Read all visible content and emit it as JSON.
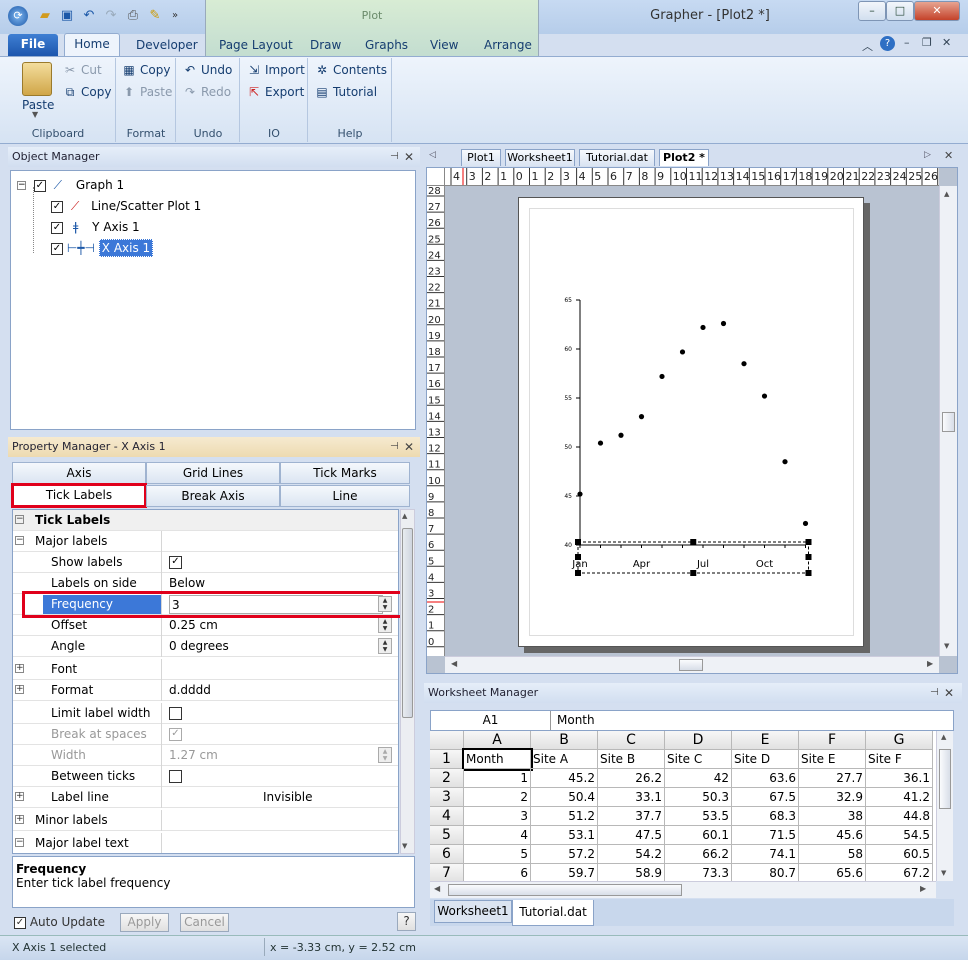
{
  "window": {
    "title": "Grapher - [Plot2 *]",
    "context_group": "Plot",
    "min": "–",
    "max": "□",
    "close": "✕"
  },
  "ribbon": {
    "tabs": [
      "File",
      "Home",
      "Developer",
      "Page Layout",
      "Draw",
      "Graphs",
      "View",
      "Arrange"
    ],
    "clipboard": {
      "label": "Clipboard",
      "paste": "Paste",
      "cut": "Cut",
      "copy": "Copy"
    },
    "format": {
      "label": "Format",
      "copy": "Copy",
      "paste": "Paste"
    },
    "undo": {
      "label": "Undo",
      "undo": "Undo",
      "redo": "Redo"
    },
    "io": {
      "label": "IO",
      "import": "Import",
      "export": "Export"
    },
    "help": {
      "label": "Help",
      "contents": "Contents",
      "tutorial": "Tutorial"
    }
  },
  "object_manager": {
    "title": "Object Manager",
    "items": [
      "Graph 1",
      "Line/Scatter Plot 1",
      "Y Axis 1",
      "X Axis 1"
    ]
  },
  "property_manager": {
    "title": "Property Manager - X Axis 1",
    "tabs": [
      "Axis",
      "Grid Lines",
      "Tick Marks",
      "Tick Labels",
      "Break Axis",
      "Line"
    ],
    "section": "Tick Labels",
    "rows": [
      {
        "label": "Major labels",
        "value": ""
      },
      {
        "label": "Show labels",
        "value": ""
      },
      {
        "label": "Labels on side",
        "value": "Below"
      },
      {
        "label": "Frequency",
        "value": "3"
      },
      {
        "label": "Offset",
        "value": "0.25 cm"
      },
      {
        "label": "Angle",
        "value": "0 degrees"
      },
      {
        "label": "Font",
        "value": ""
      },
      {
        "label": "Format",
        "value": "d.dddd"
      },
      {
        "label": "Limit label width",
        "value": ""
      },
      {
        "label": "Break at spaces",
        "value": ""
      },
      {
        "label": "Width",
        "value": "1.27 cm"
      },
      {
        "label": "Between ticks",
        "value": ""
      },
      {
        "label": "Label line",
        "value": "Invisible"
      },
      {
        "label": "Minor labels",
        "value": ""
      },
      {
        "label": "Major label text",
        "value": ""
      }
    ],
    "help_title": "Frequency",
    "help_text": "Enter tick label frequency",
    "auto_update": "Auto Update",
    "apply": "Apply",
    "cancel": "Cancel",
    "help_btn": "?"
  },
  "doc_tabs": [
    "Plot1",
    "Worksheet1",
    "Tutorial.dat",
    "Plot2 *"
  ],
  "ruler": {
    "h": [
      "4",
      "3",
      "2",
      "1",
      "0",
      "1",
      "2",
      "3",
      "4",
      "5",
      "6",
      "7",
      "8",
      "9",
      "10",
      "11",
      "12",
      "13",
      "14",
      "15",
      "16",
      "17",
      "18",
      "19",
      "20",
      "21",
      "22",
      "23",
      "24",
      "25",
      "26",
      "27"
    ],
    "v": [
      "28",
      "27",
      "26",
      "25",
      "24",
      "23",
      "22",
      "21",
      "20",
      "19",
      "18",
      "17",
      "16",
      "15",
      "14",
      "13",
      "12",
      "11",
      "10",
      "9",
      "8",
      "7",
      "6",
      "5",
      "4",
      "3",
      "2",
      "1",
      "0"
    ]
  },
  "chart_data": {
    "type": "scatter",
    "x": [
      "Jan",
      "Feb",
      "Mar",
      "Apr",
      "May",
      "Jun",
      "Jul",
      "Aug",
      "Sep",
      "Oct",
      "Nov",
      "Dec"
    ],
    "y": [
      45.2,
      50.4,
      51.2,
      53.1,
      57.2,
      59.7,
      62.2,
      62.6,
      58.5,
      55.2,
      48.5,
      42.2
    ],
    "xticklabels": [
      "Jan",
      "Apr",
      "Jul",
      "Oct"
    ],
    "yticks": [
      "65",
      "60",
      "55",
      "50",
      "45",
      "40"
    ],
    "ylim": [
      40,
      65
    ],
    "title": "",
    "xlabel": "",
    "ylabel": ""
  },
  "worksheet_manager": {
    "title": "Worksheet Manager",
    "cell_ref": "A1",
    "cell_value": "Month",
    "columns": [
      "A",
      "B",
      "C",
      "D",
      "E",
      "F",
      "G"
    ],
    "rows": [
      [
        "1",
        "Month",
        "Site A",
        "Site B",
        "Site C",
        "Site D",
        "Site E",
        "Site F"
      ],
      [
        "2",
        "1",
        "45.2",
        "26.2",
        "42",
        "63.6",
        "27.7",
        "36.1"
      ],
      [
        "3",
        "2",
        "50.4",
        "33.1",
        "50.3",
        "67.5",
        "32.9",
        "41.2"
      ],
      [
        "4",
        "3",
        "51.2",
        "37.7",
        "53.5",
        "68.3",
        "38",
        "44.8"
      ],
      [
        "5",
        "4",
        "53.1",
        "47.5",
        "60.1",
        "71.5",
        "45.6",
        "54.5"
      ],
      [
        "6",
        "5",
        "57.2",
        "54.2",
        "66.2",
        "74.1",
        "58",
        "60.5"
      ],
      [
        "7",
        "6",
        "59.7",
        "58.9",
        "73.3",
        "80.7",
        "65.6",
        "67.2"
      ]
    ],
    "sheet_tabs": [
      "Worksheet1",
      "Tutorial.dat"
    ]
  },
  "status": {
    "left": "X Axis 1 selected",
    "coords": "x = -3.33 cm, y = 2.52 cm"
  }
}
